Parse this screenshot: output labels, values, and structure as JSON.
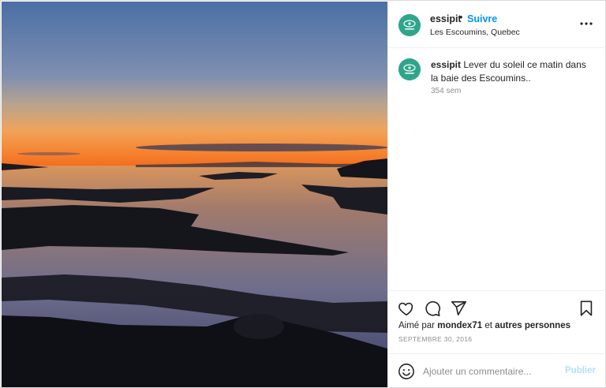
{
  "post": {
    "username": "essipit",
    "separator": "•",
    "follow_label": "Suivre",
    "location": "Les Escoumins, Quebec",
    "more_icon": "more-horizontal-icon"
  },
  "caption": {
    "username": "essipit",
    "text": "Lever du soleil ce matin dans la baie des Escoumins..",
    "time": "354 sem"
  },
  "actions": {
    "icons": [
      "heart-icon",
      "comment-icon",
      "share-icon",
      "bookmark-icon"
    ],
    "liked_prefix": "Aimé par",
    "liked_user": "mondex71",
    "liked_join": "et",
    "liked_others": "autres personnes",
    "date": "SEPTEMBRE 30, 2016"
  },
  "comment": {
    "placeholder": "Ajouter un commentaire...",
    "publish_label": "Publier",
    "emoji_icon": "emoji-icon"
  },
  "colors": {
    "accent": "#0095f6",
    "publish_disabled": "#b2dffc",
    "avatar_green": "#2fa58b"
  }
}
